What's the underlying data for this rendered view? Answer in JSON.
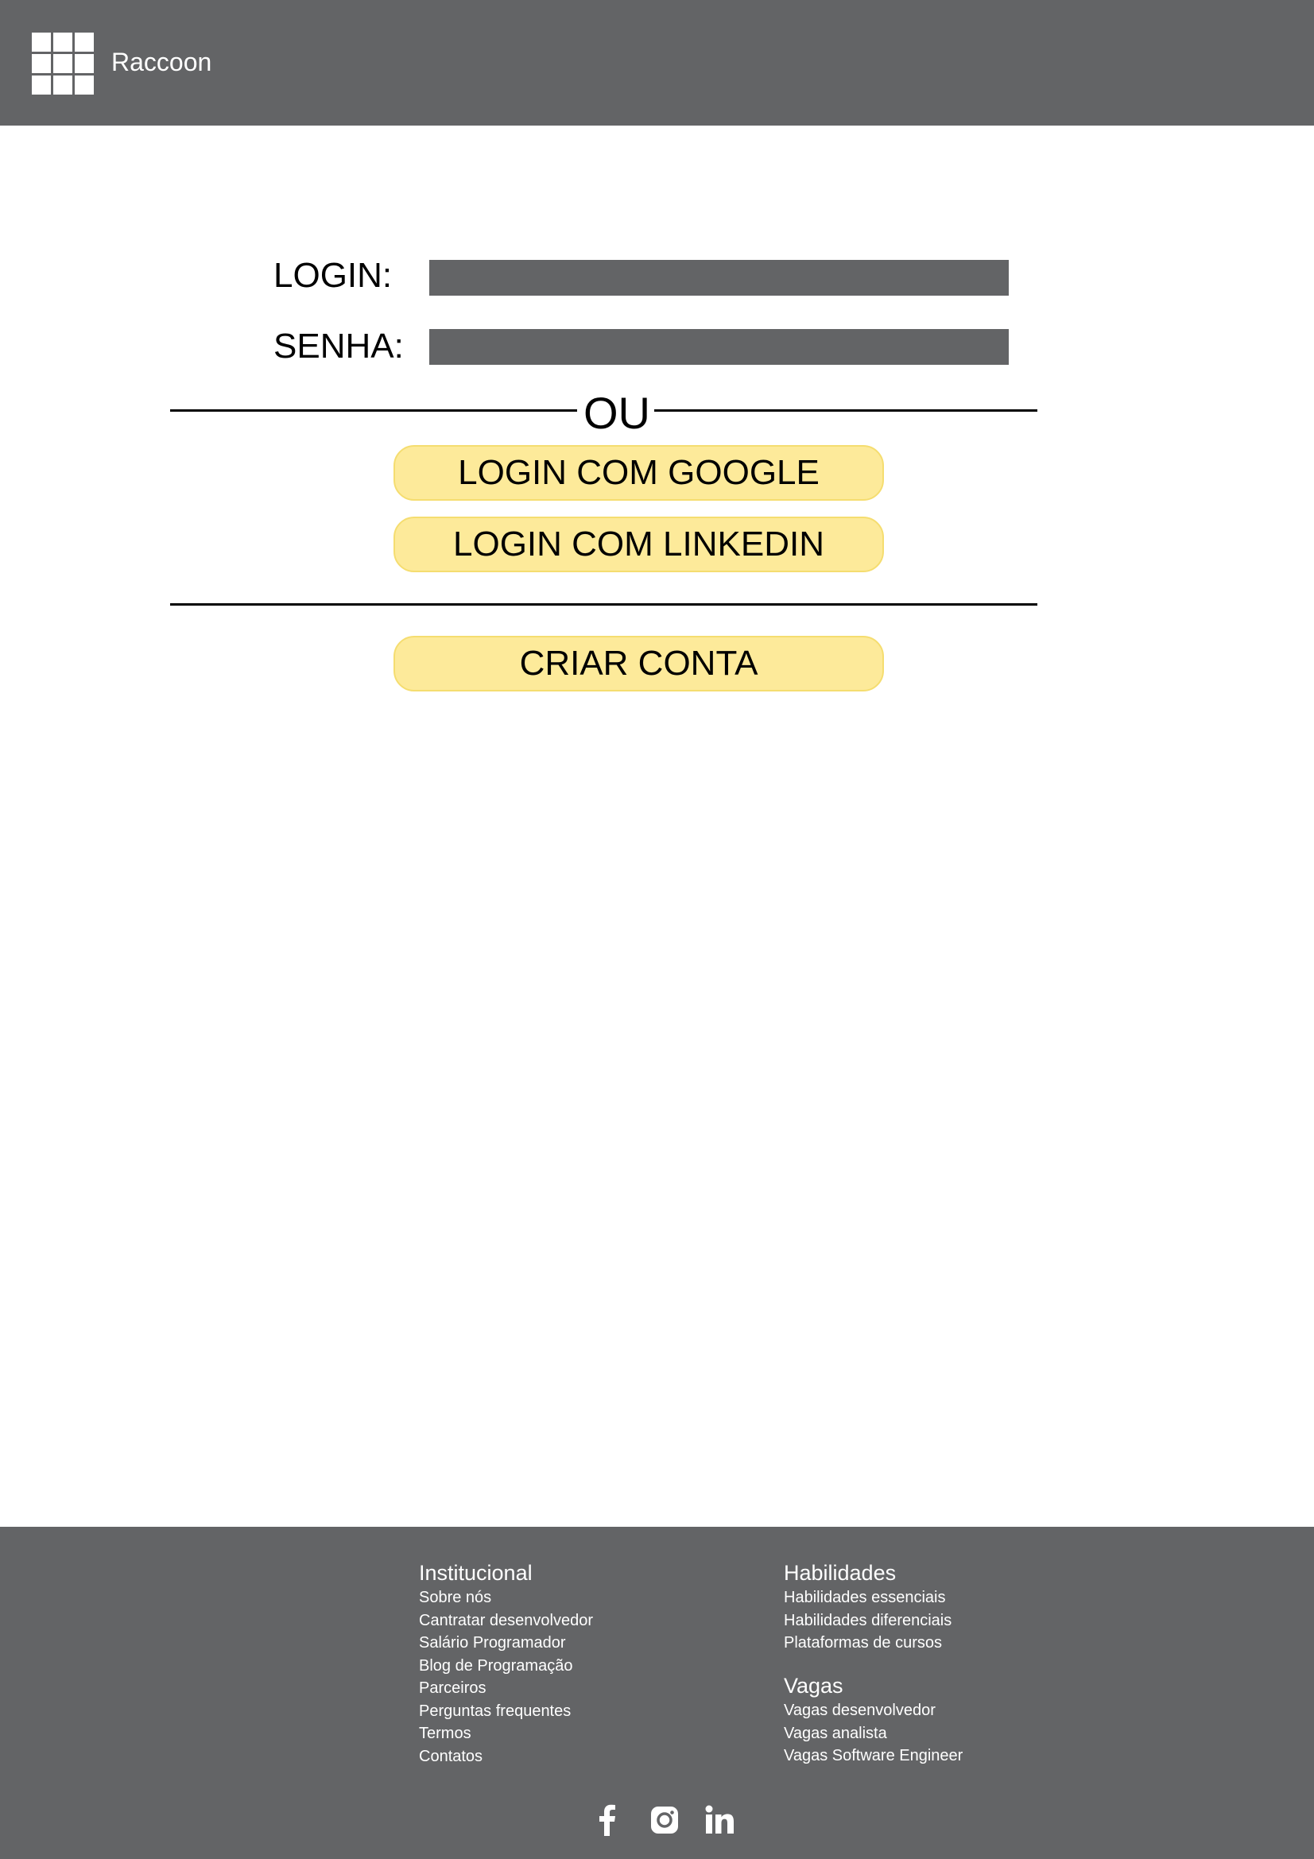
{
  "header": {
    "brand": "Raccoon"
  },
  "login_form": {
    "login_label": "LOGIN:",
    "password_label": "SENHA:",
    "login_value": "",
    "password_value": "",
    "divider_text": "OU",
    "google_button": "LOGIN COM GOOGLE",
    "linkedin_button": "LOGIN COM LINKEDIN",
    "create_account_button": "CRIAR CONTA"
  },
  "footer": {
    "institucional": {
      "title": "Institucional",
      "links": [
        "Sobre nós",
        "Cantratar desenvolvedor",
        "Salário Programador",
        "Blog de Programação",
        "Parceiros",
        "Perguntas frequentes",
        "Termos",
        "Contatos"
      ]
    },
    "habilidades": {
      "title": "Habilidades",
      "links": [
        "Habilidades essenciais",
        "Habilidades diferenciais",
        "Plataformas de cursos"
      ]
    },
    "vagas": {
      "title": "Vagas",
      "links": [
        "Vagas desenvolvedor",
        "Vagas analista",
        "Vagas Software Engineer"
      ]
    },
    "social_icons": [
      "facebook-icon",
      "instagram-icon",
      "linkedin-icon"
    ]
  },
  "colors": {
    "header_bg": "#636466",
    "button_bg": "#fdea9a",
    "field_bg": "#636466"
  }
}
